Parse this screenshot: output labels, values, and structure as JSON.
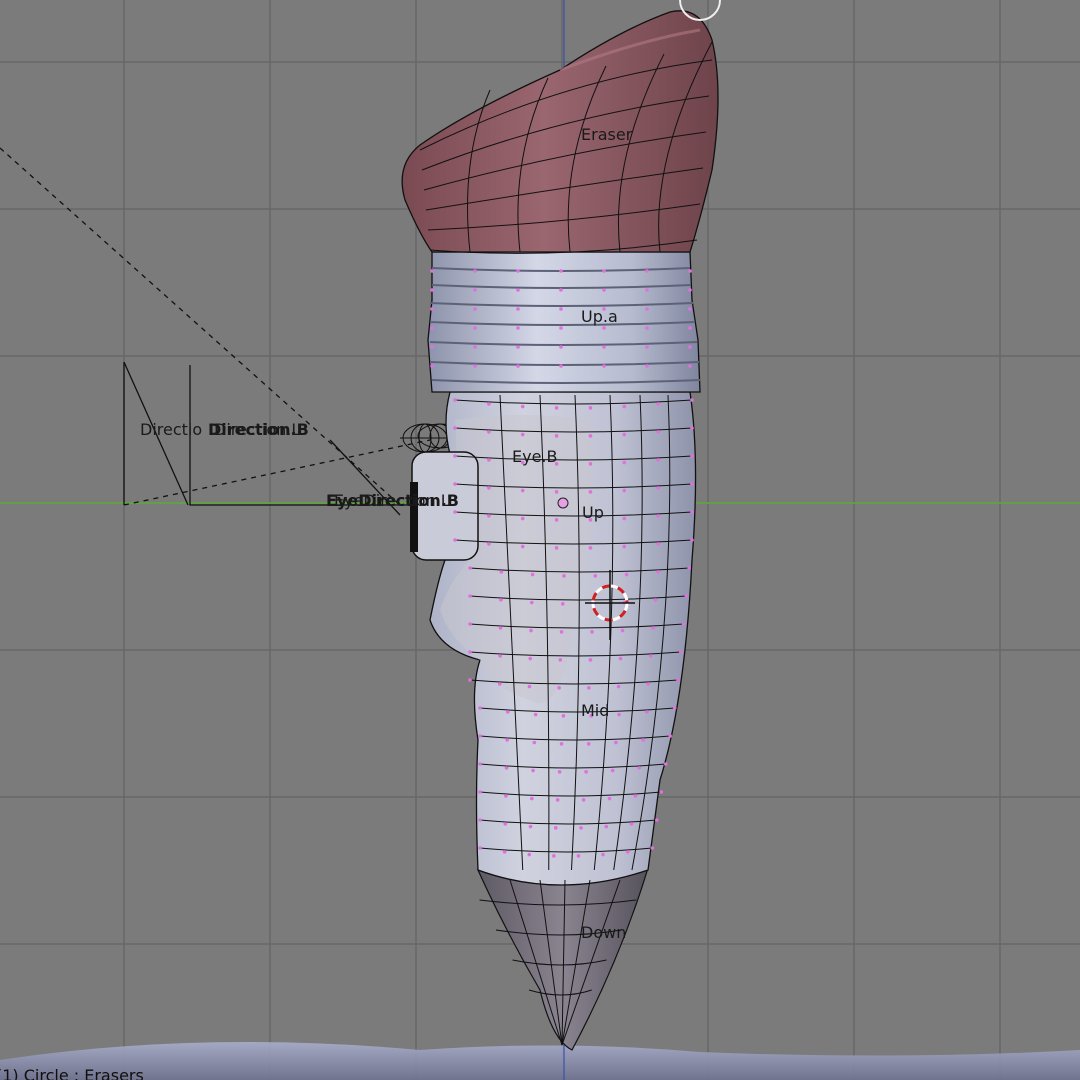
{
  "viewport": {
    "status_text": "(1) Circle : Erasers",
    "colors": {
      "background": "#7b7b7b",
      "grid": "#6a6a6a",
      "x_axis": "#5fae3a",
      "z_axis": "#3a4fb0",
      "eraser": "#8e5a63",
      "body": "#b7bcd0",
      "vertex": "#e070e0",
      "wire": "#111111"
    }
  },
  "bones": {
    "eraser": "Eraser",
    "up_a": "Up.a",
    "eye_b": "Eye.B",
    "up": "Up",
    "mid": "Mid",
    "down": "Down",
    "direction_l": "Directio",
    "direction_b": "Direction.B",
    "direction_b_shadow": "Direction.L",
    "eye_direction_b": "EyeDirection.B",
    "eye_direction_shadow": "EyeDirection.L"
  }
}
